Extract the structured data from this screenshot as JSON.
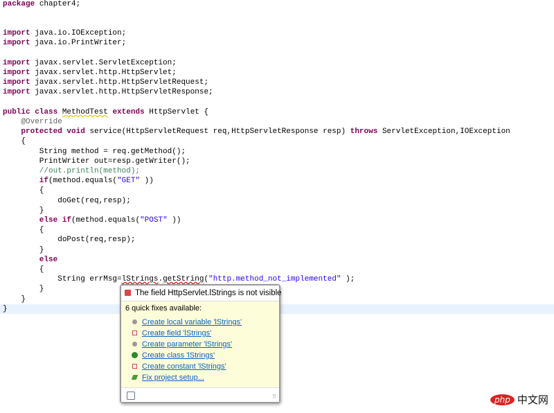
{
  "editor": {
    "lines": [
      [
        [
          "kw",
          "package"
        ],
        [
          "",
          "chapter4;"
        ]
      ],
      [],
      [],
      [
        [
          "kw",
          "import"
        ],
        [
          "",
          "java.io.IOException;"
        ]
      ],
      [
        [
          "kw",
          "import"
        ],
        [
          "",
          "java.io.PrintWriter;"
        ]
      ],
      [],
      [
        [
          "kw",
          "import"
        ],
        [
          "",
          "javax.servlet.ServletException;"
        ]
      ],
      [
        [
          "kw",
          "import"
        ],
        [
          "",
          "javax.servlet.http.HttpServlet;"
        ]
      ],
      [
        [
          "kw",
          "import"
        ],
        [
          "",
          "javax.servlet.http.HttpServletRequest;"
        ]
      ],
      [
        [
          "kw",
          "import"
        ],
        [
          "",
          "javax.servlet.http.HttpServletResponse;"
        ]
      ],
      [],
      [
        [
          "kw",
          "public class"
        ],
        [
          "warn",
          "MethodTest"
        ],
        [
          "kw",
          "extends"
        ],
        [
          "",
          "HttpServlet {"
        ]
      ],
      [
        [
          "ann",
          "    @Override"
        ]
      ],
      [
        [
          "kw",
          "    protected void"
        ],
        [
          "",
          "service(HttpServletRequest req,HttpServletResponse resp)"
        ],
        [
          "kw",
          "throws"
        ],
        [
          "",
          "ServletException,IOException"
        ]
      ],
      [
        [
          "",
          "    {"
        ]
      ],
      [
        [
          "",
          "        String method = req.getMethod();"
        ]
      ],
      [
        [
          "",
          "        PrintWriter out=resp.getWriter();"
        ]
      ],
      [
        [
          "cm",
          "        //out.println(method);"
        ]
      ],
      [
        [
          "kw",
          "        if"
        ],
        [
          "",
          "(method.equals("
        ],
        [
          "str",
          "\"GET\""
        ],
        [
          "",
          "))"
        ]
      ],
      [
        [
          "",
          "        {"
        ]
      ],
      [
        [
          "",
          "            doGet(req,resp);"
        ]
      ],
      [
        [
          "",
          "        }"
        ]
      ],
      [
        [
          "kw",
          "        else if"
        ],
        [
          "",
          "(method.equals("
        ],
        [
          "str",
          "\"POST\""
        ],
        [
          "",
          "))"
        ]
      ],
      [
        [
          "",
          "        {"
        ]
      ],
      [
        [
          "",
          "            doPost(req,resp);"
        ]
      ],
      [
        [
          "",
          "        }"
        ]
      ],
      [
        [
          "kw",
          "        else"
        ]
      ],
      [
        [
          "",
          "        {"
        ]
      ],
      [
        [
          "",
          "            String errMsg="
        ],
        [
          "err",
          "lStrings"
        ],
        [
          "",
          "."
        ],
        [
          "err",
          "getString"
        ],
        [
          "",
          "("
        ],
        [
          "str",
          "\"http.method_not_implemented\""
        ],
        [
          "",
          ");"
        ]
      ],
      [
        [
          "",
          "        }"
        ]
      ],
      [
        [
          "",
          "    }"
        ]
      ],
      [
        [
          "",
          "}"
        ]
      ]
    ],
    "current_line": 31
  },
  "popup": {
    "title": "The field HttpServlet.lStrings is not visible",
    "count": "6 quick fixes available:",
    "fixes": [
      {
        "label": "Create local variable 'lStrings'",
        "icon": "local-variable-icon"
      },
      {
        "label": "Create field 'lStrings'",
        "icon": "field-icon"
      },
      {
        "label": "Create parameter 'lStrings'",
        "icon": "parameter-icon"
      },
      {
        "label": "Create class 'lStrings'",
        "icon": "class-icon"
      },
      {
        "label": "Create constant 'lStrings'",
        "icon": "constant-icon"
      },
      {
        "label": "Fix project setup...",
        "icon": "fix-icon"
      }
    ]
  },
  "watermark": {
    "brand": "php",
    "text": "中文网"
  }
}
